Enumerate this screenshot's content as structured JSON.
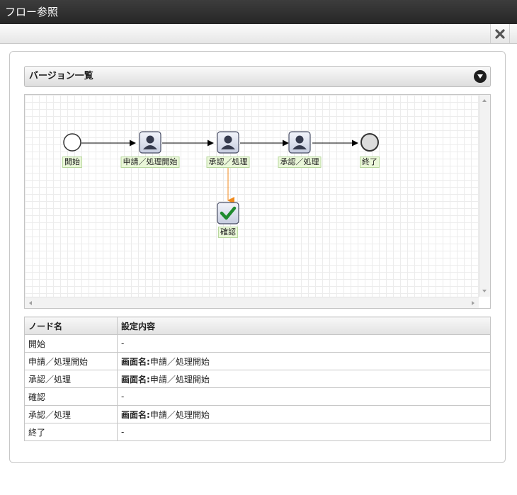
{
  "window": {
    "title": "フロー参照"
  },
  "section": {
    "title": "バージョン一覧"
  },
  "flow": {
    "nodes": [
      {
        "id": "start",
        "type": "start",
        "label": "開始"
      },
      {
        "id": "apply",
        "type": "user",
        "label": "申請／処理開始"
      },
      {
        "id": "approve1",
        "type": "user",
        "label": "承認／処理"
      },
      {
        "id": "approve2",
        "type": "user",
        "label": "承認／処理"
      },
      {
        "id": "end",
        "type": "end",
        "label": "終了"
      },
      {
        "id": "confirm",
        "type": "check",
        "label": "確認"
      }
    ]
  },
  "table": {
    "headers": [
      "ノード名",
      "設定内容"
    ],
    "rows": [
      {
        "name": "開始",
        "key": "",
        "value": "-"
      },
      {
        "name": "申請／処理開始",
        "key": "画面名:",
        "value": "申請／処理開始"
      },
      {
        "name": "承認／処理",
        "key": "画面名:",
        "value": "申請／処理開始"
      },
      {
        "name": "確認",
        "key": "",
        "value": "-"
      },
      {
        "name": "承認／処理",
        "key": "画面名:",
        "value": "申請／処理開始"
      },
      {
        "name": "終了",
        "key": "",
        "value": "-"
      }
    ]
  },
  "colors": {
    "flow_line": "#000000",
    "confirm_line": "#f08a1c",
    "label_bg": "#eaf7d9",
    "check": "#1e8a2e"
  }
}
